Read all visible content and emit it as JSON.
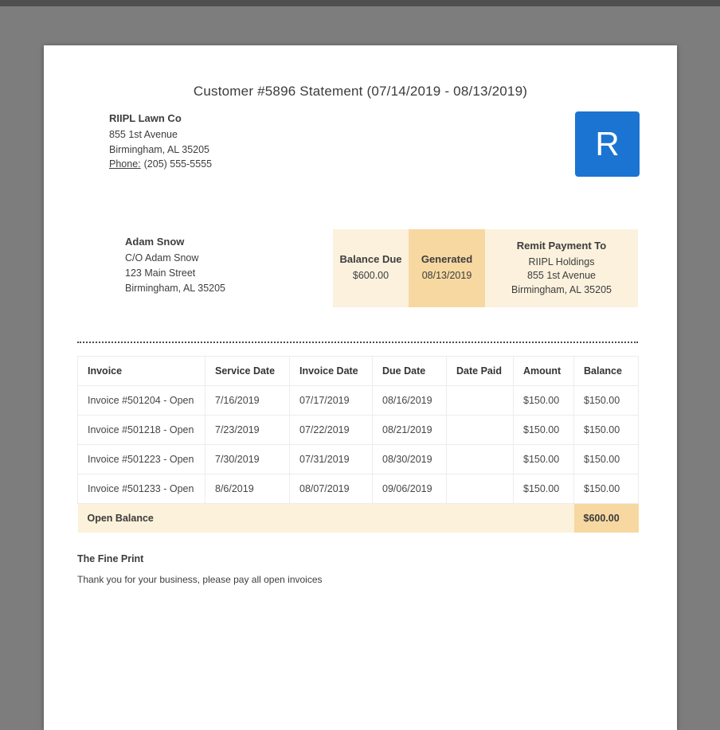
{
  "statement": {
    "title": "Customer #5896 Statement (07/14/2019 - 08/13/2019)"
  },
  "company": {
    "name": "RIIPL Lawn Co",
    "address_line1": "855 1st Avenue",
    "address_line2": "Birmingham, AL 35205",
    "phone_label": "Phone:",
    "phone": "(205) 555-5555",
    "logo_letter": "R"
  },
  "customer": {
    "name": "Adam Snow",
    "line1": "C/O Adam Snow",
    "line2": "123 Main Street",
    "line3": "Birmingham, AL 35205"
  },
  "summary": {
    "balance_due_label": "Balance Due",
    "balance_due_value": "$600.00",
    "generated_label": "Generated",
    "generated_value": "08/13/2019",
    "remit_label": "Remit Payment To",
    "remit_line1": "RIIPL Holdings",
    "remit_line2": "855 1st Avenue",
    "remit_line3": "Birmingham, AL 35205"
  },
  "invoice_table": {
    "headers": [
      "Invoice",
      "Service Date",
      "Invoice Date",
      "Due Date",
      "Date Paid",
      "Amount",
      "Balance"
    ],
    "rows": [
      [
        "Invoice #501204 - Open",
        "7/16/2019",
        "07/17/2019",
        "08/16/2019",
        "",
        "$150.00",
        "$150.00"
      ],
      [
        "Invoice #501218 - Open",
        "7/23/2019",
        "07/22/2019",
        "08/21/2019",
        "",
        "$150.00",
        "$150.00"
      ],
      [
        "Invoice #501223 - Open",
        "7/30/2019",
        "07/31/2019",
        "08/30/2019",
        "",
        "$150.00",
        "$150.00"
      ],
      [
        "Invoice #501233 - Open",
        "8/6/2019",
        "08/07/2019",
        "09/06/2019",
        "",
        "$150.00",
        "$150.00"
      ]
    ],
    "footer": {
      "label": "Open Balance",
      "balance": "$600.00"
    }
  },
  "fine_print": {
    "heading": "The Fine Print",
    "text": "Thank you for your business, please pay all open invoices"
  },
  "colors": {
    "accent_blue": "#1b74d1",
    "cream": "#fbf1dd",
    "orange": "#f7d8a1",
    "viewer_background": "#7d7d7d"
  }
}
